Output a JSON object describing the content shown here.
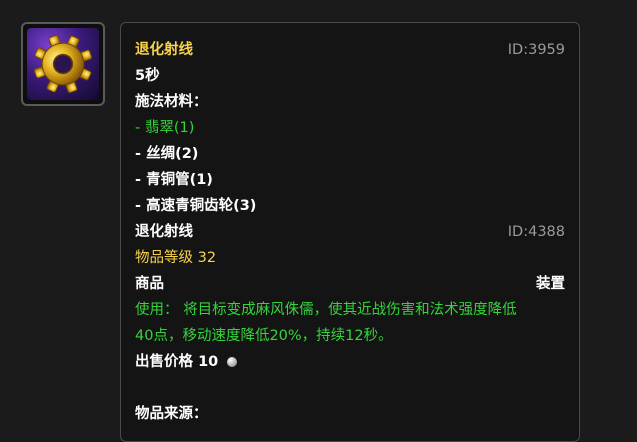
{
  "icon": {
    "name": "gear-icon"
  },
  "spell": {
    "name": "退化射线",
    "id": "ID:3959",
    "cast_time": "5秒"
  },
  "materials": {
    "header": "施法材料：",
    "items": [
      "- 翡翠(1)",
      "- 丝绸(2)",
      "- 青铜管(1)",
      "- 高速青铜齿轮(3)"
    ]
  },
  "item": {
    "name": "退化射线",
    "id": "ID:4388",
    "level": "物品等级 32",
    "type": "商品",
    "slot": "装置",
    "use_text_1": "使用： 将目标变成麻风侏儒，使其近战伤害和法术强度降低",
    "use_text_2": "40点，移动速度降低20%，持续12秒。",
    "sell_label": "出售价格",
    "sell_value": "10",
    "source_label": "物品来源："
  },
  "colors": {
    "gold": "#f8d24a",
    "green": "#35d43c",
    "gray": "#9a9a9a",
    "white": "#ffffff",
    "background": "#1b1b1b"
  }
}
